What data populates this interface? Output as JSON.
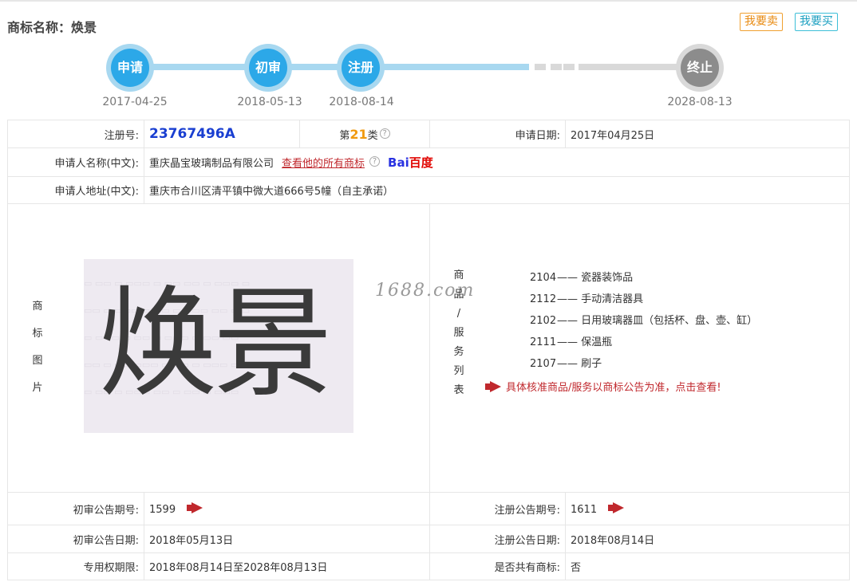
{
  "header": {
    "title": "商标名称：焕景",
    "sell_label": "我要卖",
    "buy_label": "我要买"
  },
  "timeline": [
    {
      "label": "申请",
      "date": "2017-04-25"
    },
    {
      "label": "初审",
      "date": "2018-05-13"
    },
    {
      "label": "注册",
      "date": "2018-08-14"
    },
    {
      "label": "终止",
      "date": "2028-08-13"
    }
  ],
  "info": {
    "reg_no_label": "注册号:",
    "reg_no": "23767496A",
    "class_prefix": "第",
    "class_num": "21",
    "class_suffix": "类",
    "apply_date_label": "申请日期:",
    "apply_date": "2017年04月25日",
    "applicant_label": "申请人名称(中文):",
    "applicant": "重庆晶宝玻璃制品有限公司",
    "view_all_link": "查看他的所有商标",
    "baidu_a": "Bai",
    "baidu_b": "百度",
    "address_label": "申请人地址(中文):",
    "address": "重庆市合川区清平镇中微大道666号5幢（自主承诺）",
    "image_label_chars": [
      "商",
      "标",
      "图",
      "片"
    ],
    "trademark_text": "焕景",
    "service_label_chars": [
      "商",
      "品",
      "/",
      "服",
      "务",
      "列",
      "表"
    ],
    "services": [
      {
        "code": "2104",
        "name": "—— 瓷器装饰品"
      },
      {
        "code": "2112",
        "name": "—— 手动清洁器具"
      },
      {
        "code": "2102",
        "name": "—— 日用玻璃器皿（包括杯、盘、壶、缸）"
      },
      {
        "code": "2111",
        "name": "—— 保温瓶"
      },
      {
        "code": "2107",
        "name": "—— 刷子"
      }
    ],
    "service_note": "具体核准商品/服务以商标公告为准，点击查看!",
    "watermark": "1688.com",
    "prelim_no_label": "初审公告期号:",
    "prelim_no": "1599",
    "reg_pub_no_label": "注册公告期号:",
    "reg_pub_no": "1611",
    "prelim_date_label": "初审公告日期:",
    "prelim_date": "2018年05月13日",
    "reg_pub_date_label": "注册公告日期:",
    "reg_pub_date": "2018年08月14日",
    "exclusive_label": "专用权期限:",
    "exclusive_period": "2018年08月14日至2028年08月13日",
    "shared_label": "是否共有商标:",
    "shared": "否"
  }
}
